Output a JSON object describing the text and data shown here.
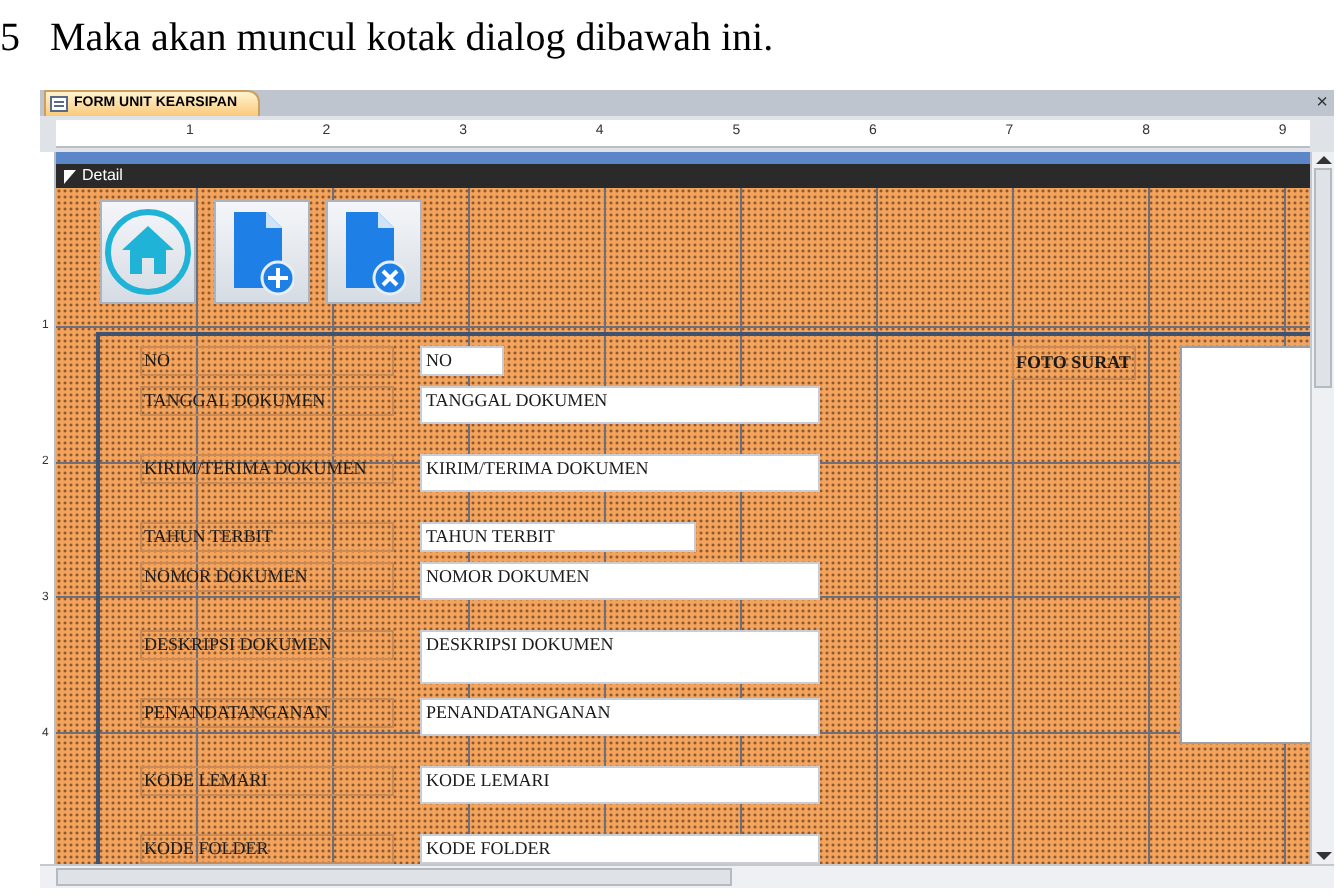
{
  "caption": {
    "number": "5",
    "text": "Maka akan muncul kotak dialog dibawah ini."
  },
  "window": {
    "tab": "FORM UNIT KEARSIPAN",
    "close": "×"
  },
  "ruler": [
    "1",
    "2",
    "3",
    "4",
    "5",
    "6",
    "7",
    "8",
    "9"
  ],
  "vertical_ruler": [
    "1",
    "2",
    "3",
    "4"
  ],
  "section": {
    "title": "Detail"
  },
  "buttons": [
    {
      "kind": "home"
    },
    {
      "kind": "new"
    },
    {
      "kind": "delete"
    }
  ],
  "fields": [
    {
      "label": "NO",
      "value": "NO"
    },
    {
      "label": "TANGGAL DOKUMEN",
      "value": "TANGGAL DOKUMEN"
    },
    {
      "label": "KIRIM/TERIMA DOKUMEN",
      "value": "KIRIM/TERIMA DOKUMEN"
    },
    {
      "label": "TAHUN TERBIT",
      "value": "TAHUN TERBIT"
    },
    {
      "label": "NOMOR DOKUMEN",
      "value": "NOMOR DOKUMEN"
    },
    {
      "label": "DESKRIPSI DOKUMEN",
      "value": "DESKRIPSI DOKUMEN"
    },
    {
      "label": "PENANDATANGANAN",
      "value": "PENANDATANGANAN"
    },
    {
      "label": "KODE LEMARI",
      "value": "KODE LEMARI"
    },
    {
      "label": "KODE FOLDER",
      "value": "KODE FOLDER"
    }
  ],
  "photo": {
    "label": "FOTO SURAT",
    "kind": "picture"
  }
}
